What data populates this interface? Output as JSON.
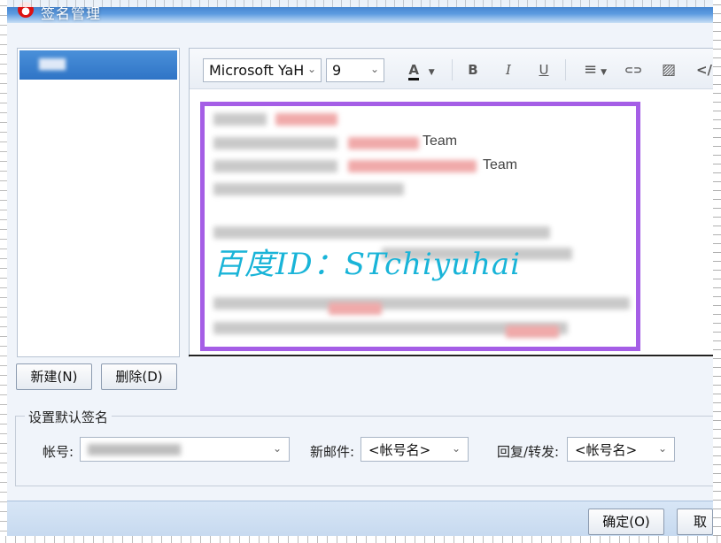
{
  "window": {
    "title": "签名管理"
  },
  "editor": {
    "font_family": "Microsoft YaH",
    "font_size": "9",
    "toolbar_icons": [
      "font-color-icon",
      "bold-icon",
      "italic-icon",
      "underline-icon",
      "align-icon",
      "link-icon",
      "image-icon",
      "source-icon"
    ],
    "toolbar_glyphs": {
      "font_color": "A",
      "bold": "B",
      "italic": "I",
      "underline": "U",
      "align": "≡",
      "link": "⊂⊃",
      "image": "▨",
      "source": "</"
    },
    "content": {
      "team_line_1": "Team",
      "team_line_2": "Team",
      "watermark": "百度ID：STchiyuhai"
    },
    "frame_color": "#a55ee6"
  },
  "buttons": {
    "new_label": "新建(N)",
    "delete_label": "删除(D)",
    "ok_label": "确定(O)",
    "cancel_label": "取消"
  },
  "default_signature": {
    "group_title": "设置默认签名",
    "account_label": "帐号:",
    "new_mail_label": "新邮件:",
    "new_mail_value": "<帐号名>",
    "reply_label": "回复/转发:",
    "reply_value": "<帐号名>"
  },
  "colors": {
    "title_bar": "#2e6fc0",
    "selection": "#2f74c6",
    "watermark": "#19b4d8"
  }
}
